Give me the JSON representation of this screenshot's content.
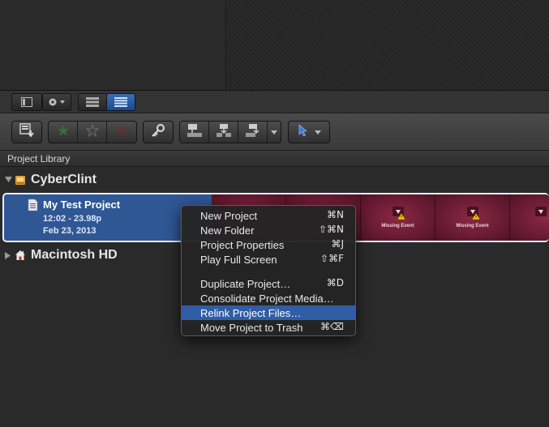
{
  "library": {
    "header": "Project Library",
    "volumes": [
      {
        "name": "CyberClint",
        "expanded": true
      },
      {
        "name": "Macintosh HD",
        "expanded": false
      }
    ],
    "project": {
      "name": "My Test Project",
      "duration": "12:02 - 23.98p",
      "date": "Feb 23, 2013"
    },
    "clip_label": "Missing Event"
  },
  "context_menu": {
    "items": [
      {
        "label": "New Project",
        "shortcut": "⌘N"
      },
      {
        "label": "New Folder",
        "shortcut": "⇧⌘N"
      },
      {
        "label": "Project Properties",
        "shortcut": "⌘J"
      },
      {
        "label": "Play Full Screen",
        "shortcut": "⇧⌘F"
      },
      {
        "label": "Duplicate Project…",
        "shortcut": "⌘D"
      },
      {
        "label": "Consolidate Project Media…",
        "shortcut": ""
      },
      {
        "label": "Relink Project Files…",
        "shortcut": "",
        "highlighted": true
      },
      {
        "label": "Move Project to Trash",
        "shortcut": "⌘⌫"
      }
    ]
  },
  "icons": {
    "toolbar_small": [
      "sidebar-toggle-icon",
      "gear-icon",
      "filmstrip-view-icon",
      "list-view-icon"
    ],
    "toolbar_big": [
      "import-icon",
      "favorite-star-icon",
      "unrate-star-icon",
      "reject-x-icon",
      "keyword-key-icon",
      "connect-clip-icon",
      "insert-clip-icon",
      "append-clip-icon",
      "select-arrow-icon"
    ]
  },
  "colors": {
    "selection": "#2f5794",
    "menu_highlight": "#2f5da6",
    "missing_clip": "#7a2340",
    "active_tool": "#3a7bd5"
  }
}
